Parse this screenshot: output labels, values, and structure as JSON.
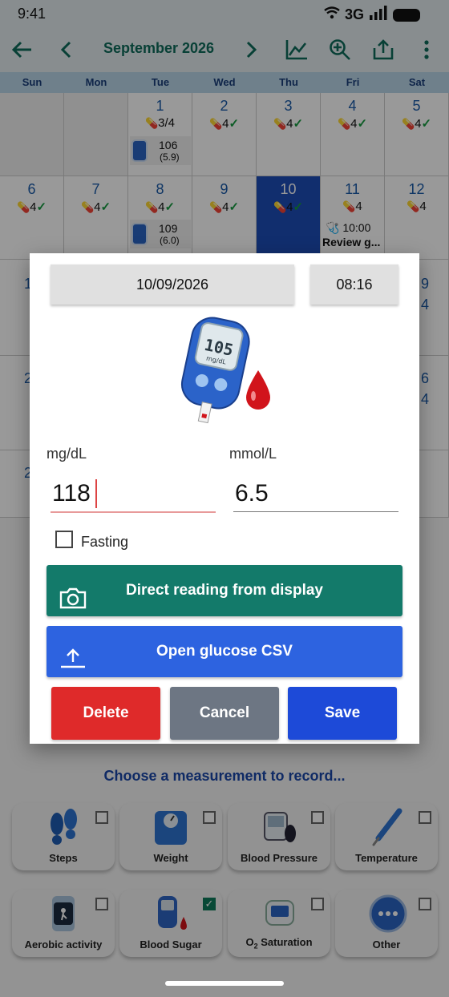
{
  "status": {
    "time": "9:41",
    "network": "3G"
  },
  "toolbar": {
    "month": "September 2026"
  },
  "weekdays": [
    "Sun",
    "Mon",
    "Tue",
    "Wed",
    "Thu",
    "Fri",
    "Sat"
  ],
  "calendar": {
    "week1": [
      {
        "day": "1",
        "meds": "3/4",
        "check": "",
        "glucose_mg": "106",
        "glucose_mmol": "(5.9)"
      },
      {
        "day": "2",
        "meds": "4",
        "check": "✓"
      },
      {
        "day": "3",
        "meds": "4",
        "check": "✓"
      },
      {
        "day": "4",
        "meds": "4",
        "check": "✓"
      },
      {
        "day": "5",
        "meds": "4",
        "check": "✓"
      }
    ],
    "week2": [
      {
        "day": "6",
        "meds": "4",
        "check": "✓"
      },
      {
        "day": "7",
        "meds": "4",
        "check": "✓"
      },
      {
        "day": "8",
        "meds": "4",
        "check": "✓",
        "glucose_mg": "109",
        "glucose_mmol": "(6.0)"
      },
      {
        "day": "9",
        "meds": "4",
        "check": "✓"
      },
      {
        "day": "10",
        "meds": "4",
        "check": "✓"
      },
      {
        "day": "11",
        "meds": "4",
        "check": "",
        "event_time": "10:00",
        "event_title": "Review g..."
      },
      {
        "day": "12",
        "meds": "4",
        "check": ""
      }
    ],
    "side_left": [
      "1",
      "2",
      "2"
    ],
    "side_right": [
      "9",
      "4",
      "6",
      "4"
    ]
  },
  "dialog": {
    "date": "10/09/2026",
    "time": "08:16",
    "unit_mg": "mg/dL",
    "unit_mmol": "mmol/L",
    "value_mg": "118",
    "value_mmol": "6.5",
    "fasting_label": "Fasting",
    "direct_label": "Direct reading from display",
    "csv_label": "Open glucose CSV",
    "delete_label": "Delete",
    "cancel_label": "Cancel",
    "save_label": "Save",
    "meter_reading": "105",
    "meter_unit": "mg/dL"
  },
  "choose_label": "Choose a measurement to record...",
  "tiles": [
    {
      "label": "Steps",
      "checked": false
    },
    {
      "label": "Weight",
      "checked": false
    },
    {
      "label": "Blood Pressure",
      "checked": false
    },
    {
      "label": "Temperature",
      "checked": false
    },
    {
      "label": "Aerobic activity",
      "checked": false
    },
    {
      "label": "Blood Sugar",
      "checked": true
    },
    {
      "label": "Saturation",
      "checked": false,
      "prefix": "O",
      "sub": "2"
    },
    {
      "label": "Other",
      "checked": false
    }
  ],
  "colors": {
    "accent": "#0e6b5a",
    "today": "#1d4db7",
    "save": "#1d4ad8",
    "delete": "#df2a2a"
  }
}
